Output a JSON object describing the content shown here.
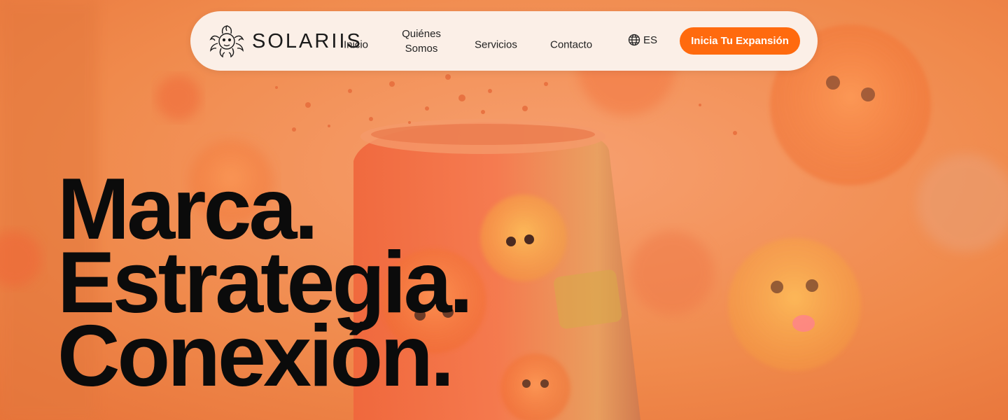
{
  "brand": {
    "name": "SOLARIIS",
    "logo_icon": "medusa-emblem-icon"
  },
  "nav": {
    "items": [
      {
        "label": "Inicio"
      },
      {
        "label": "Quiénes Somos"
      },
      {
        "label": "Servicios"
      },
      {
        "label": "Contacto"
      }
    ],
    "language": {
      "icon": "globe-icon",
      "label": "ES"
    },
    "cta_label": "Inicia Tu Expansión"
  },
  "hero": {
    "lines": [
      "Marca.",
      "Estrategia.",
      "Conexión."
    ]
  },
  "colors": {
    "accent": "#ff6a0e",
    "nav_bg": "#fbefe7",
    "hero_overlay": "#f0864a",
    "text": "#0b0b0b"
  }
}
